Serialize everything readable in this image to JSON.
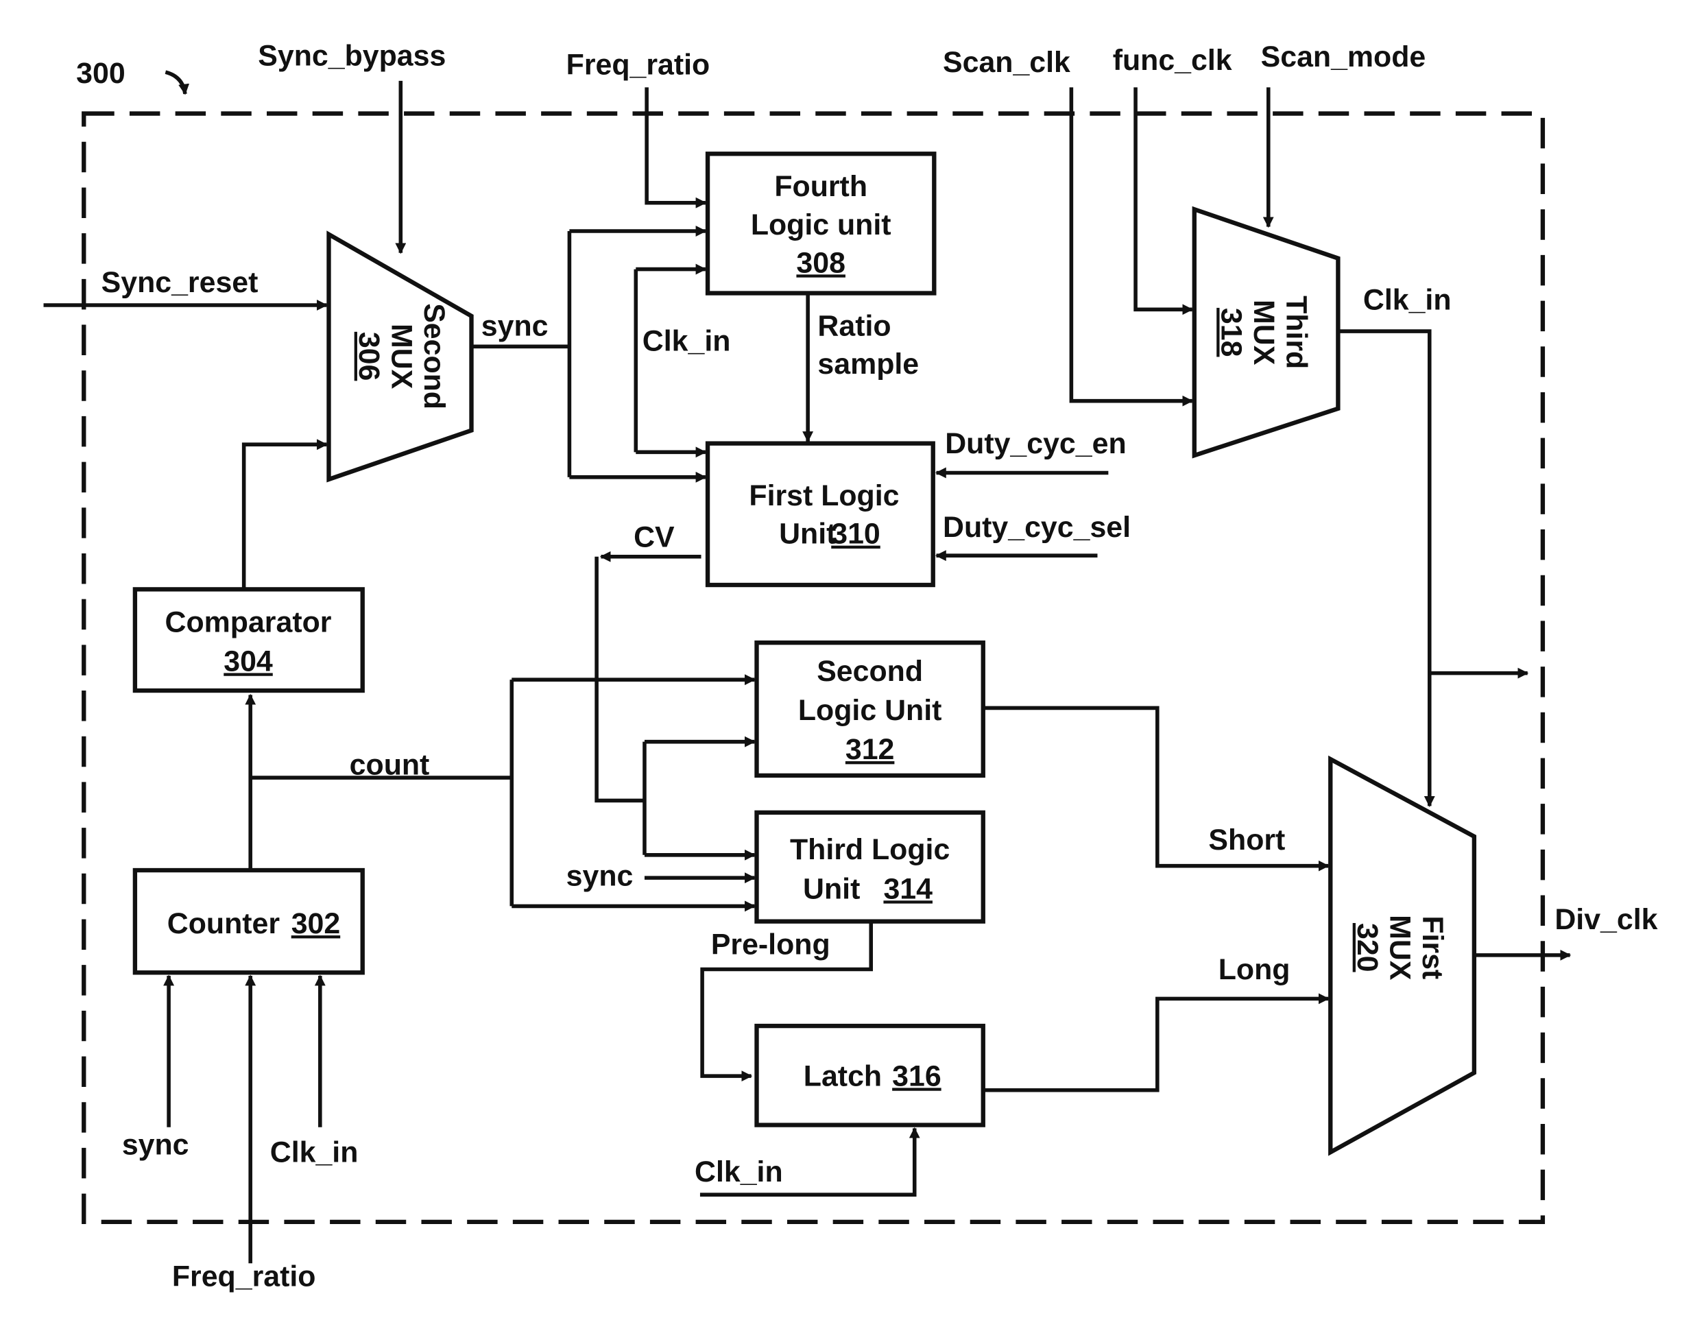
{
  "figure_ref": "300",
  "blocks": {
    "counter": {
      "name": "Counter",
      "num": "302"
    },
    "comparator": {
      "name": "Comparator",
      "num": "304"
    },
    "second_mux": {
      "name1": "Second",
      "name2": "MUX",
      "num": "306"
    },
    "fourth_logic": {
      "line1": "Fourth",
      "line2": "Logic unit",
      "num": "308"
    },
    "first_logic": {
      "line1": "First Logic",
      "line2": "Unit",
      "num": "310"
    },
    "second_logic": {
      "line1": "Second",
      "line2": "Logic Unit",
      "num": "312"
    },
    "third_logic": {
      "line1": "Third Logic",
      "line2": "Unit",
      "num": "314"
    },
    "latch": {
      "name": "Latch",
      "num": "316"
    },
    "third_mux": {
      "name1": "Third",
      "name2": "MUX",
      "num": "318"
    },
    "first_mux": {
      "name1": "First",
      "name2": "MUX",
      "num": "320"
    }
  },
  "signals": {
    "sync_bypass": "Sync_bypass",
    "freq_ratio_top": "Freq_ratio",
    "scan_clk": "Scan_clk",
    "func_clk": "func_clk",
    "scan_mode": "Scan_mode",
    "sync_reset": "Sync_reset",
    "sync_out": "sync",
    "clk_in_mid": "Clk_in",
    "ratio_sample_1": "Ratio",
    "ratio_sample_2": "sample",
    "clk_in_mux3": "Clk_in",
    "duty_cyc_en": "Duty_cyc_en",
    "duty_cyc_sel": "Duty_cyc_sel",
    "cv": "CV",
    "count": "count",
    "sync_third": "sync",
    "pre_long": "Pre-long",
    "short": "Short",
    "long": "Long",
    "div_clk": "Div_clk",
    "sync_counter": "sync",
    "clk_in_counter": "Clk_in",
    "freq_ratio_bottom": "Freq_ratio",
    "clk_in_latch": "Clk_in"
  }
}
